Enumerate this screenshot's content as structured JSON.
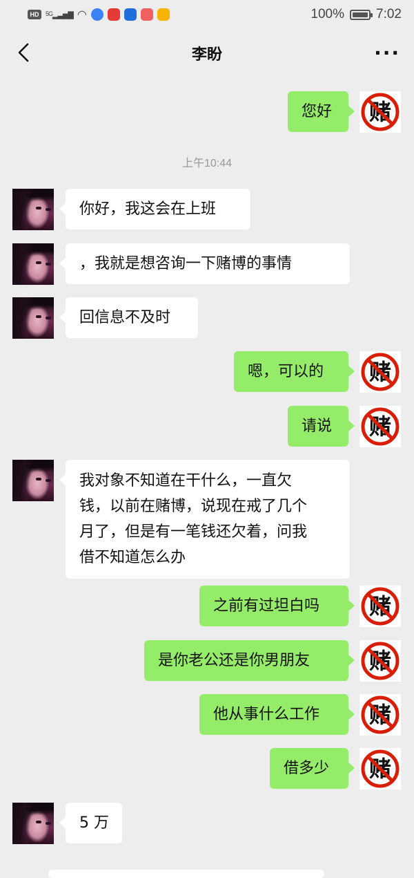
{
  "status_bar": {
    "hd": "HD",
    "signal": "5G",
    "battery_percent": "100%",
    "battery_level": 1.0,
    "time": "7:02",
    "app_icons": [
      {
        "name": "browser-icon",
        "color": "#3b82f6"
      },
      {
        "name": "notes-icon",
        "color": "#e53935"
      },
      {
        "name": "bulb-icon",
        "color": "#1e6fd9"
      },
      {
        "name": "app-icon",
        "color": "#f06060"
      },
      {
        "name": "weibo-icon",
        "color": "#f5b400"
      }
    ]
  },
  "nav": {
    "title": "李盼",
    "back_icon": "chevron-left-icon",
    "more_icon": "more-icon",
    "more_label": "···"
  },
  "timestamp": "上午10:44",
  "messages": [
    {
      "side": "right",
      "text": "您好"
    },
    {
      "side": "left",
      "text": "你好，我这会在上班"
    },
    {
      "side": "left",
      "text": "，我就是想咨询一下赌博的事情"
    },
    {
      "side": "left",
      "text": "回信息不及时"
    },
    {
      "side": "right",
      "text": "嗯，可以的"
    },
    {
      "side": "right",
      "text": "请说"
    },
    {
      "side": "left",
      "lines": [
        "我对象不知道在干什么，一直欠",
        "钱，以前在赌博，说现在戒了几个",
        "月了，但是有一笔钱还欠着，问我",
        "借不知道怎么办"
      ]
    },
    {
      "side": "right",
      "text": "之前有过坦白吗"
    },
    {
      "side": "right",
      "text": "是你老公还是你男朋友"
    },
    {
      "side": "right",
      "text": "他从事什么工作"
    },
    {
      "side": "right",
      "text": "借多少"
    },
    {
      "side": "left",
      "text": "5 万"
    }
  ],
  "self_avatar": {
    "glyph": "赌",
    "ring_color": "#d81e06"
  },
  "colors": {
    "bubble_self": "#95ec69",
    "bubble_other": "#ffffff",
    "background": "#ededed"
  }
}
